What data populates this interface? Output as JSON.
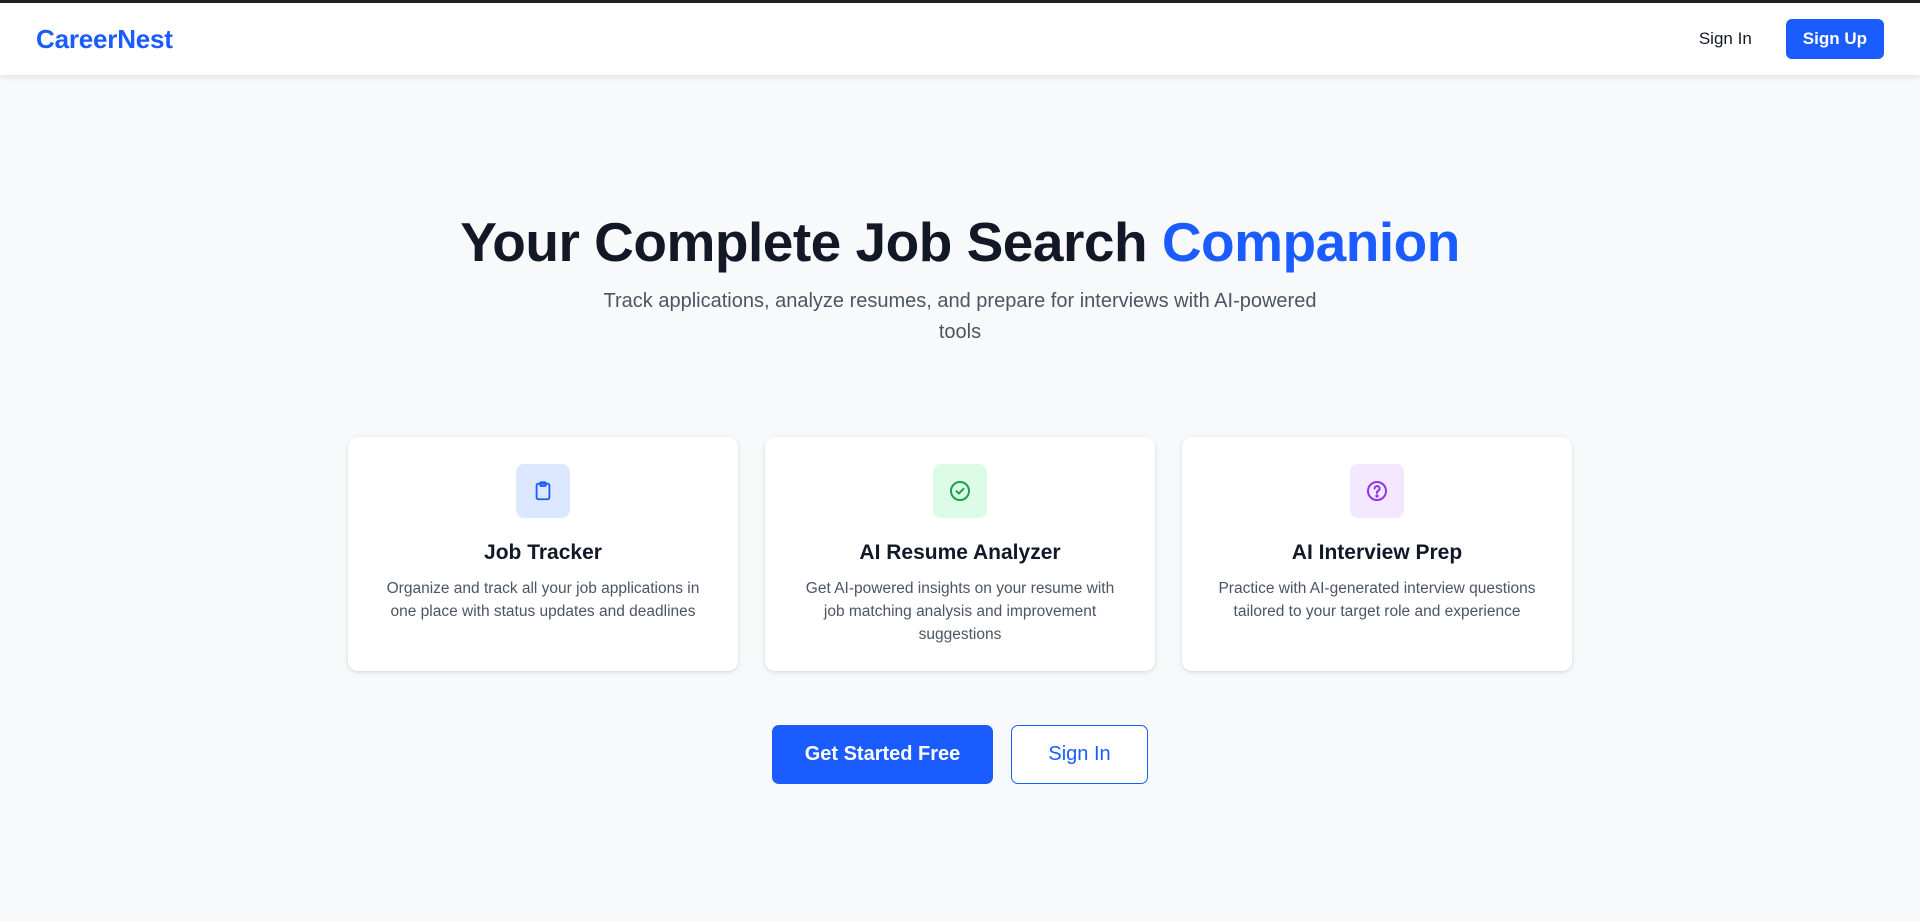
{
  "app": {
    "brand": "CareerNest"
  },
  "nav": {
    "sign_in": "Sign In",
    "sign_up": "Sign Up"
  },
  "hero": {
    "title_main": "Your Complete Job Search ",
    "title_accent": "Companion",
    "subtitle": "Track applications, analyze resumes, and prepare for interviews with AI-powered tools"
  },
  "features": [
    {
      "title": "Job Tracker",
      "description": "Organize and track all your job applications in one place with status updates and deadlines",
      "icon": "clipboard-icon",
      "icon_bg": "#dce8ff",
      "icon_color": "#1a5cff"
    },
    {
      "title": "AI Resume Analyzer",
      "description": "Get AI-powered insights on your resume with job matching analysis and improvement suggestions",
      "icon": "check-circle-icon",
      "icon_bg": "#dcfce7",
      "icon_color": "#16a34a"
    },
    {
      "title": "AI Interview Prep",
      "description": "Practice with AI-generated interview questions tailored to your target role and experience",
      "icon": "question-circle-icon",
      "icon_bg": "#f3e8ff",
      "icon_color": "#9333ea"
    }
  ],
  "cta": {
    "primary": "Get Started Free",
    "secondary": "Sign In"
  },
  "colors": {
    "brand": "#1a5cff",
    "heading": "#121826",
    "body_text": "#4b5563",
    "page_bg": "#f8f9fb"
  }
}
